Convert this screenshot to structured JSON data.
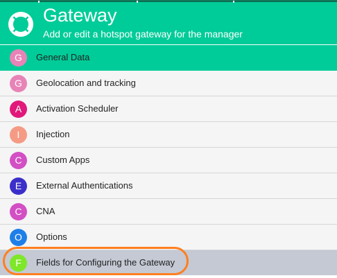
{
  "header": {
    "title": "Gateway",
    "subtitle": "Add or edit a hotspot gateway for the manager",
    "icon": "lifebuoy-icon",
    "color": "#00cc99"
  },
  "menu": {
    "items": [
      {
        "letter": "G",
        "label": "General Data",
        "color": "#e883b8",
        "state": "active"
      },
      {
        "letter": "G",
        "label": "Geolocation and tracking",
        "color": "#e883b8",
        "state": "normal"
      },
      {
        "letter": "A",
        "label": "Activation Scheduler",
        "color": "#e0197a",
        "state": "normal"
      },
      {
        "letter": "I",
        "label": "Injection",
        "color": "#f59b85",
        "state": "normal"
      },
      {
        "letter": "C",
        "label": "Custom Apps",
        "color": "#d24fc4",
        "state": "normal"
      },
      {
        "letter": "E",
        "label": "External Authentications",
        "color": "#3b2fc9",
        "state": "normal"
      },
      {
        "letter": "C",
        "label": "CNA",
        "color": "#d24fc4",
        "state": "normal"
      },
      {
        "letter": "O",
        "label": "Options",
        "color": "#1f7fe8",
        "state": "normal"
      },
      {
        "letter": "F",
        "label": "Fields for Configuring the Gateway",
        "color": "#7ee72a",
        "state": "highlighted"
      }
    ]
  },
  "annotation": {
    "color": "#ff7f1f"
  }
}
